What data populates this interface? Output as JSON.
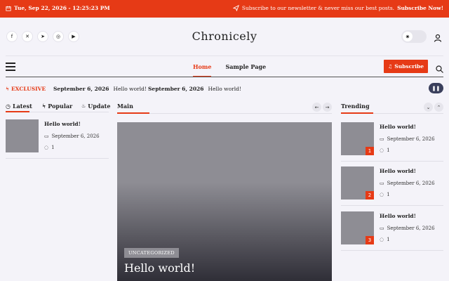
{
  "topbar": {
    "date": "Tue, Sep 22, 2026 - 12:25:23 PM",
    "newsletter_text": "Subscribe to our newsletter & never miss our best posts.",
    "newsletter_link": "Subscribe Now!"
  },
  "header": {
    "site_title": "Chronicely",
    "socials": [
      "facebook-icon",
      "x-icon",
      "telegram-icon",
      "instagram-icon",
      "youtube-icon"
    ]
  },
  "nav": {
    "items": [
      "Home",
      "Sample Page"
    ],
    "subscribe_label": "Subscribe"
  },
  "ticker": {
    "label": "EXCLUSIVE",
    "items": [
      {
        "date": "September 6, 2026",
        "title": "Hello world!"
      },
      {
        "date": "September 6, 2026",
        "title": "Hello world!"
      }
    ]
  },
  "left_tabs": [
    "Latest",
    "Popular",
    "Update"
  ],
  "latest_posts": [
    {
      "title": "Hello world!",
      "date": "September 6, 2026",
      "comments": "1"
    }
  ],
  "main": {
    "heading": "Main",
    "category": "UNCATEGORIZED",
    "title": "Hello world!"
  },
  "trending": {
    "heading": "Trending",
    "posts": [
      {
        "rank": "1",
        "title": "Hello world!",
        "date": "September 6, 2026",
        "comments": "1"
      },
      {
        "rank": "2",
        "title": "Hello world!",
        "date": "September 6, 2026",
        "comments": "1"
      },
      {
        "rank": "3",
        "title": "Hello world!",
        "date": "September 6, 2026",
        "comments": "1"
      }
    ]
  },
  "colors": {
    "accent": "#e63a16",
    "background": "#f4f3f9"
  }
}
